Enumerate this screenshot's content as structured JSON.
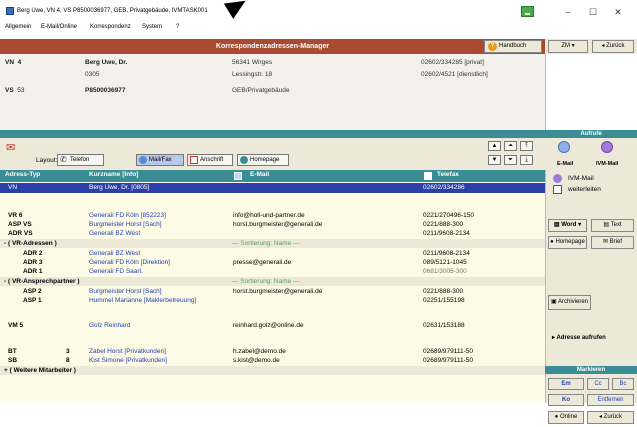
{
  "window": {
    "title": "Berg Uwe, VN 4, VS P8500036977, GEB, Privatgebäude, IVMTASK001",
    "min": "–",
    "max": "☐",
    "close": "✕"
  },
  "menu": [
    "Allgemein",
    "E-Mail/Online",
    "Korrespondenz",
    "System",
    "?"
  ],
  "header": {
    "title": "Korrespondenzadressen-Manager",
    "help": "Handbuch",
    "zm": "ZM",
    "back": "Zurück"
  },
  "info": {
    "vn_label": "VN",
    "vn_no": "4",
    "name": "Berg Uwe, Dr.",
    "vn_code": "0305",
    "city": "56341 Wirges",
    "street": "Lessingstr. 18",
    "phone1": "02602/334285 [privat]",
    "phone2": "02602/4521 [dienstlich]",
    "vs_label": "VS",
    "vs_no": "53",
    "vs_code": "P8500036977",
    "vs_desc": "GEB/Privatgebäude"
  },
  "aufrufe": {
    "label": "Aufrufe",
    "email": "E-Mail",
    "ivm": "IVM-Mail",
    "ivm_item": "IVM-Mail",
    "forward": "weiterleiten"
  },
  "layout": {
    "label": "Layout:",
    "buttons": [
      "Telefon",
      "Mail/Fax",
      "Anschrift",
      "Homepage"
    ]
  },
  "columns": {
    "type": "Adress-Typ",
    "short": "Kurzname [Info]",
    "email": "E-Mail",
    "fax": "Telefax"
  },
  "selected": {
    "type": "VN",
    "short": "Berg Uwe, Dr. [0805]",
    "fax": "02602/334286"
  },
  "rows": [
    {
      "t": "VR 6",
      "s": "Generali FD Köln [852223]",
      "e": "info@holl-und-partner.de",
      "f": "0221/270496-150"
    },
    {
      "t": "ASP VS",
      "s": "Burgmeister Horst [Sach]",
      "e": "horst.burgmeister@generali.de",
      "f": "0221/888-300"
    },
    {
      "t": "ADR VS",
      "s": "Generali BZ West",
      "e": "",
      "f": "0211/9608-2134"
    }
  ],
  "group1": {
    "label": "- ( VR-Adressen )",
    "sort": "— Sortierung: Name —"
  },
  "rows2": [
    {
      "t": "ADR 2",
      "s": "Generali BZ West",
      "e": "",
      "f": "0211/9608-2134"
    },
    {
      "t": "ADR 3",
      "s": "Generali FD Köln [Direktion]",
      "e": "presse@generali.de",
      "f": "089/5121-1045"
    },
    {
      "t": "ADR 1",
      "s": "Generali FD Saarl.",
      "e": "",
      "f": "0681/3005-300"
    }
  ],
  "group2": {
    "label": "- ( VR-Ansprechpartner )",
    "sort": "— Sortierung: Name —"
  },
  "rows3": [
    {
      "t": "ASP 2",
      "s": "Burgmeister Horst [Sach]",
      "e": "horst.burgmeister@generali.de",
      "f": "0221/888-300"
    },
    {
      "t": "ASP 1",
      "s": "Hummel Marianne [Maklerbetreuung]",
      "e": "",
      "f": "02251/155198"
    }
  ],
  "vm": {
    "t": "VM 5",
    "s": "Golz Reinhard",
    "e": "reinhard.golz@online.de",
    "f": "02631/153188"
  },
  "rows4": [
    {
      "t": "BT",
      "n": "3",
      "s": "Zabel Horst [Privatkunden]",
      "e": "h.zabel@demo.de",
      "f": "02689/979111-50"
    },
    {
      "t": "SB",
      "n": "8",
      "s": "Kist Simone [Privatkunden]",
      "e": "s.kist@demo.de",
      "f": "02689/979111-50"
    }
  ],
  "group3": {
    "label": "+ ( Weitere Mitarbeiter )"
  },
  "side": {
    "word": "Word",
    "text": "Text",
    "homepage": "Homepage",
    "brief": "Brief",
    "archive": "Archivieren",
    "addr": "Adresse aufrufen"
  },
  "mark": {
    "label": "Markieren",
    "em": "Em",
    "cc": "Cc",
    "bc": "Bc",
    "ko": "Ko",
    "remove": "Entfernen",
    "online": "Online",
    "back": "Zurück"
  }
}
